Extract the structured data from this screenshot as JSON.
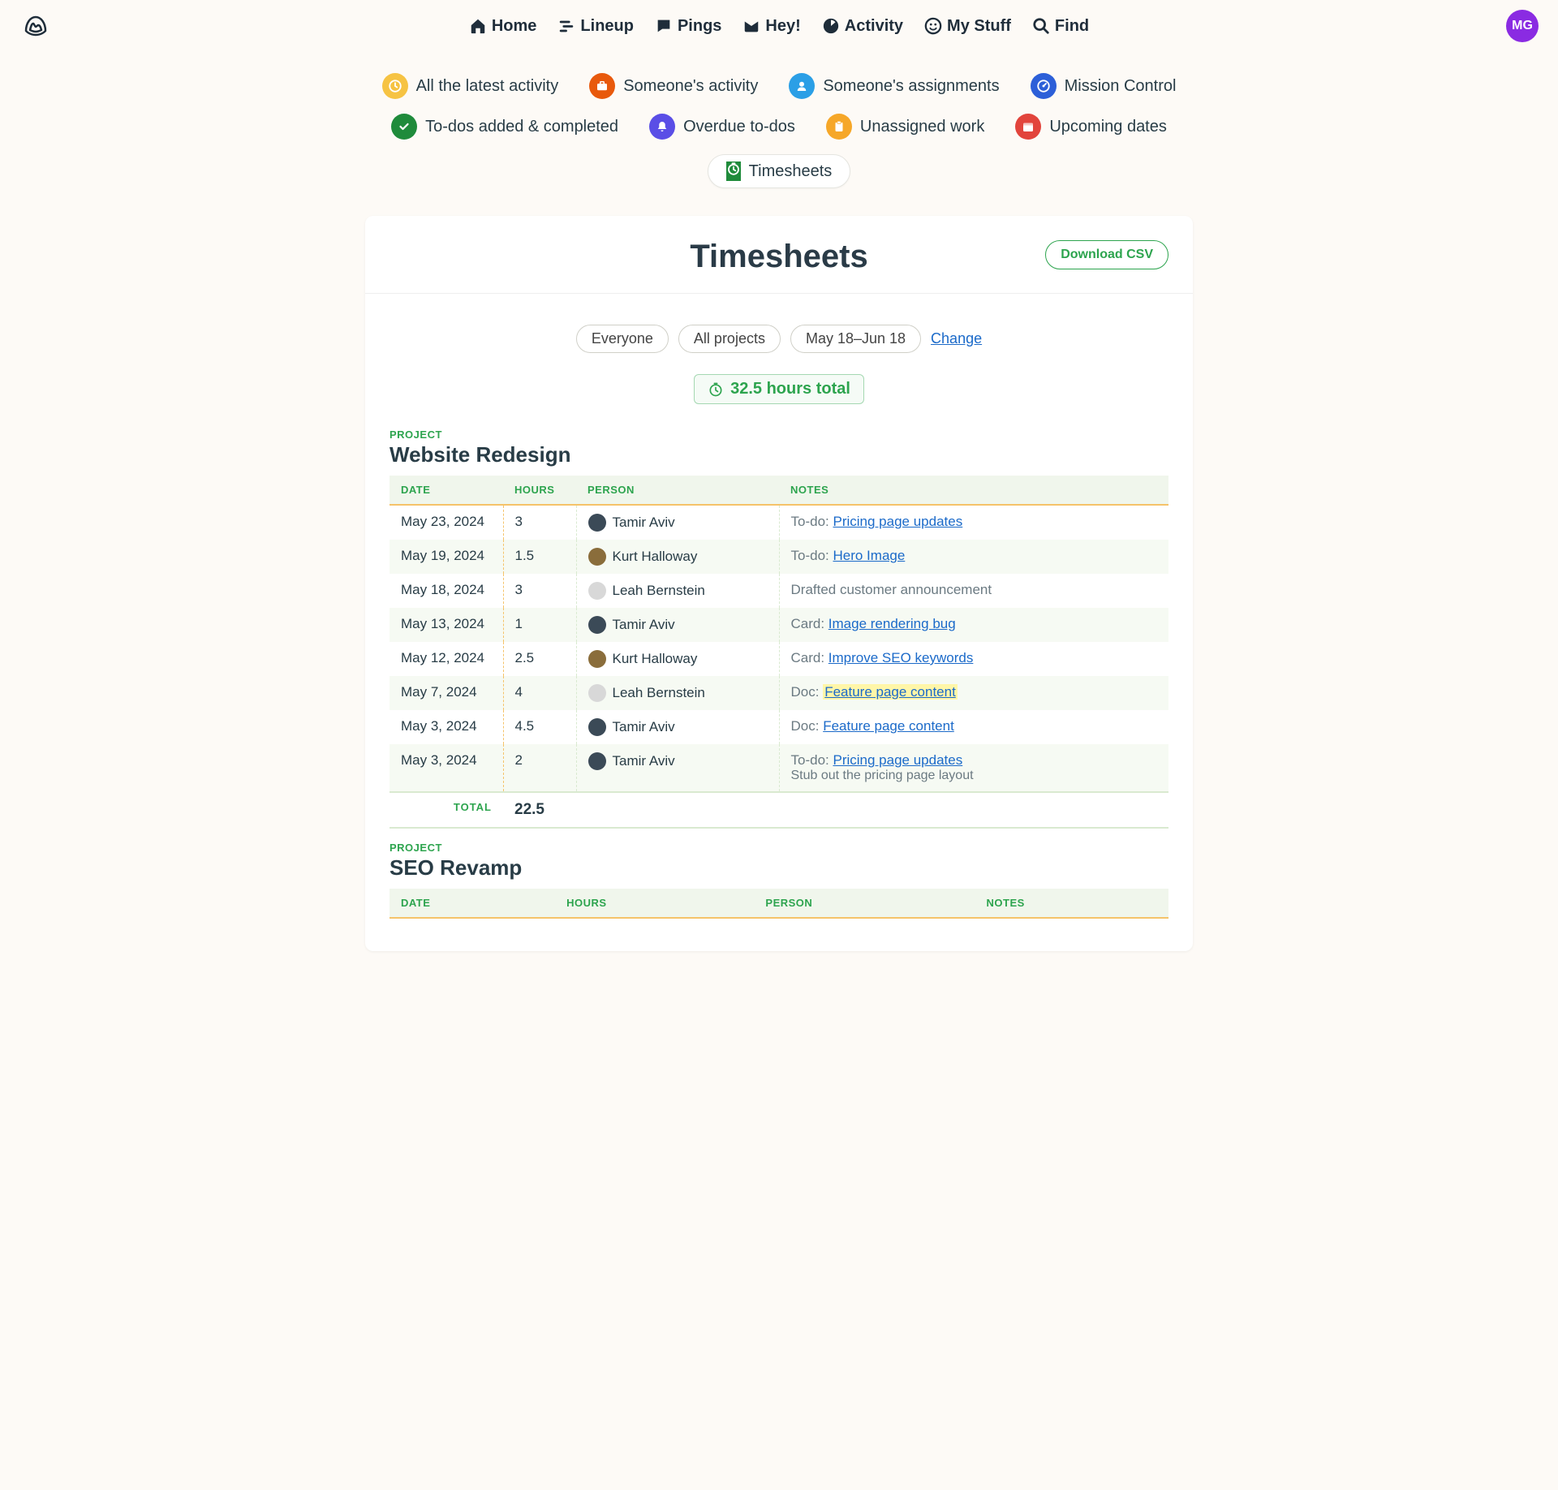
{
  "nav": {
    "home": "Home",
    "lineup": "Lineup",
    "pings": "Pings",
    "hey": "Hey!",
    "activity": "Activity",
    "mystuff": "My Stuff",
    "find": "Find"
  },
  "user": {
    "initials": "MG"
  },
  "subnav": {
    "latest": "All the latest activity",
    "someone_activity": "Someone's activity",
    "someone_assignments": "Someone's assignments",
    "mission_control": "Mission Control",
    "todos": "To-dos added & completed",
    "overdue": "Overdue to-dos",
    "unassigned": "Unassigned work",
    "upcoming": "Upcoming dates",
    "timesheets": "Timesheets"
  },
  "page": {
    "title": "Timesheets",
    "download": "Download CSV",
    "filters": {
      "who": "Everyone",
      "project": "All projects",
      "range": "May 18–Jun 18",
      "change": "Change"
    },
    "total_hours": "32.5 hours total"
  },
  "columns": {
    "date": "DATE",
    "hours": "HOURS",
    "person": "PERSON",
    "notes": "NOTES"
  },
  "project_kicker": "PROJECT",
  "total_label": "TOTAL",
  "projects": [
    {
      "name": "Website Redesign",
      "total": "22.5",
      "rows": [
        {
          "date": "May 23, 2024",
          "hours": "3",
          "person": "Tamir Aviv",
          "avatar_bg": "#3b4a57",
          "prefix": "To-do: ",
          "link": "Pricing page updates"
        },
        {
          "date": "May 19, 2024",
          "hours": "1.5",
          "person": "Kurt Halloway",
          "avatar_bg": "#8a6d3b",
          "prefix": "To-do: ",
          "link": "Hero Image"
        },
        {
          "date": "May 18, 2024",
          "hours": "3",
          "person": "Leah Bernstein",
          "avatar_bg": "#d8d8d8",
          "text": "Drafted customer announcement"
        },
        {
          "date": "May 13, 2024",
          "hours": "1",
          "person": "Tamir Aviv",
          "avatar_bg": "#3b4a57",
          "prefix": "Card: ",
          "link": "Image rendering bug"
        },
        {
          "date": "May 12, 2024",
          "hours": "2.5",
          "person": "Kurt Halloway",
          "avatar_bg": "#8a6d3b",
          "prefix": "Card: ",
          "link": "Improve SEO keywords"
        },
        {
          "date": "May 7, 2024",
          "hours": "4",
          "person": "Leah Bernstein",
          "avatar_bg": "#d8d8d8",
          "prefix": "Doc: ",
          "link": "Feature page content",
          "highlight": true
        },
        {
          "date": "May 3, 2024",
          "hours": "4.5",
          "person": "Tamir Aviv",
          "avatar_bg": "#3b4a57",
          "prefix": "Doc: ",
          "link": "Feature page content"
        },
        {
          "date": "May 3, 2024",
          "hours": "2",
          "person": "Tamir Aviv",
          "avatar_bg": "#3b4a57",
          "prefix": "To-do: ",
          "link": "Pricing page updates",
          "sub": "Stub out the pricing page layout"
        }
      ]
    },
    {
      "name": "SEO Revamp",
      "rows": []
    }
  ]
}
